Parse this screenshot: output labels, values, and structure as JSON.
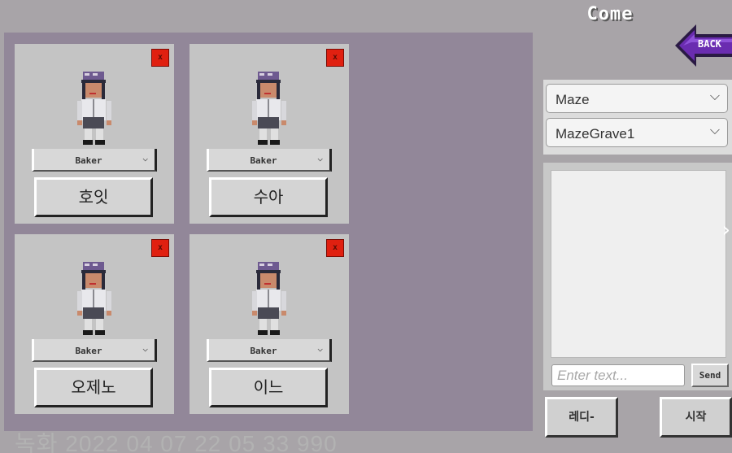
{
  "room": {
    "title": "Come"
  },
  "back_button": {
    "label": "BACK"
  },
  "slots": [
    {
      "job": "Baker",
      "name": "호잇",
      "kick": "x"
    },
    {
      "job": "Baker",
      "name": "수아",
      "kick": "x"
    },
    {
      "job": "Baker",
      "name": "오제노",
      "kick": "x"
    },
    {
      "job": "Baker",
      "name": "이느",
      "kick": "x"
    }
  ],
  "map_selector": {
    "region": "Maze",
    "map": "MazeGrave1"
  },
  "chat": {
    "input_placeholder": "Enter text...",
    "send_label": "Send"
  },
  "actions": {
    "ready_label": "레디-",
    "start_label": "시작"
  },
  "footer": {
    "timestamp": "녹화 2022 04 07 22 05 33 990"
  },
  "icons": {
    "chevron": "chevron-down-icon",
    "arrow": "chevron-right-icon",
    "back": "back-arrow-icon"
  },
  "colors": {
    "panel": "#928799",
    "card": "#c4c4c4",
    "kick": "#e02010",
    "back_arrow": "#6a2cb0"
  }
}
